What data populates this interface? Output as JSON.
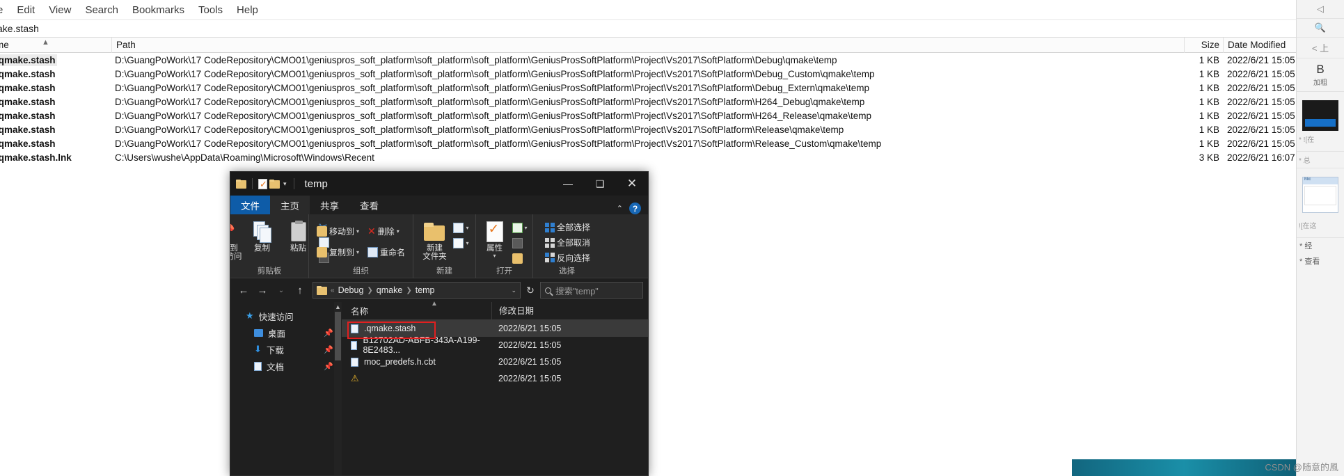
{
  "app": {
    "menu": [
      "e",
      "Edit",
      "View",
      "Search",
      "Bookmarks",
      "Tools",
      "Help"
    ],
    "search_value": "ake.stash",
    "columns": {
      "name": "me",
      "path": "Path",
      "size": "Size",
      "date": "Date Modified"
    },
    "rows": [
      {
        "name": ".qmake.stash",
        "path": "D:\\GuangPoWork\\17 CodeRepository\\CMO01\\geniuspros_soft_platform\\soft_platform\\soft_platform\\GeniusProsSoftPlatform\\Project\\Vs2017\\SoftPlatform\\Debug\\qmake\\temp",
        "size": "1 KB",
        "date": "2022/6/21 15:05",
        "selected": true
      },
      {
        "name": ".qmake.stash",
        "path": "D:\\GuangPoWork\\17 CodeRepository\\CMO01\\geniuspros_soft_platform\\soft_platform\\soft_platform\\GeniusProsSoftPlatform\\Project\\Vs2017\\SoftPlatform\\Debug_Custom\\qmake\\temp",
        "size": "1 KB",
        "date": "2022/6/21 15:05",
        "selected": false
      },
      {
        "name": ".qmake.stash",
        "path": "D:\\GuangPoWork\\17 CodeRepository\\CMO01\\geniuspros_soft_platform\\soft_platform\\soft_platform\\GeniusProsSoftPlatform\\Project\\Vs2017\\SoftPlatform\\Debug_Extern\\qmake\\temp",
        "size": "1 KB",
        "date": "2022/6/21 15:05",
        "selected": false
      },
      {
        "name": ".qmake.stash",
        "path": "D:\\GuangPoWork\\17 CodeRepository\\CMO01\\geniuspros_soft_platform\\soft_platform\\soft_platform\\GeniusProsSoftPlatform\\Project\\Vs2017\\SoftPlatform\\H264_Debug\\qmake\\temp",
        "size": "1 KB",
        "date": "2022/6/21 15:05",
        "selected": false
      },
      {
        "name": ".qmake.stash",
        "path": "D:\\GuangPoWork\\17 CodeRepository\\CMO01\\geniuspros_soft_platform\\soft_platform\\soft_platform\\GeniusProsSoftPlatform\\Project\\Vs2017\\SoftPlatform\\H264_Release\\qmake\\temp",
        "size": "1 KB",
        "date": "2022/6/21 15:05",
        "selected": false
      },
      {
        "name": ".qmake.stash",
        "path": "D:\\GuangPoWork\\17 CodeRepository\\CMO01\\geniuspros_soft_platform\\soft_platform\\soft_platform\\GeniusProsSoftPlatform\\Project\\Vs2017\\SoftPlatform\\Release\\qmake\\temp",
        "size": "1 KB",
        "date": "2022/6/21 15:05",
        "selected": false
      },
      {
        "name": ".qmake.stash",
        "path": "D:\\GuangPoWork\\17 CodeRepository\\CMO01\\geniuspros_soft_platform\\soft_platform\\soft_platform\\GeniusProsSoftPlatform\\Project\\Vs2017\\SoftPlatform\\Release_Custom\\qmake\\temp",
        "size": "1 KB",
        "date": "2022/6/21 15:05",
        "selected": false
      },
      {
        "name": ".qmake.stash.lnk",
        "path": "C:\\Users\\wushe\\AppData\\Roaming\\Microsoft\\Windows\\Recent",
        "size": "3 KB",
        "date": "2022/6/21 16:07",
        "selected": false
      }
    ]
  },
  "explorer": {
    "title": "temp",
    "window_buttons": {
      "minimize": "—",
      "maximize": "❑",
      "close": "✕"
    },
    "tabs": [
      {
        "label": "文件",
        "kind": "file"
      },
      {
        "label": "主页",
        "kind": "active"
      },
      {
        "label": "共享",
        "kind": "normal"
      },
      {
        "label": "查看",
        "kind": "normal"
      }
    ],
    "help_label": "?",
    "collapse_caret": "⌃",
    "ribbon": {
      "groups": [
        {
          "label": "剪贴板",
          "big": [
            {
              "caption_line1": "固定到",
              "caption_line2": "快速访问",
              "icon": "pin-icon"
            },
            {
              "caption_line1": "复制",
              "caption_line2": "",
              "icon": "copy-icon"
            },
            {
              "caption_line1": "粘贴",
              "caption_line2": "",
              "icon": "paste-icon"
            }
          ],
          "small": [
            {
              "label": "",
              "icon": "cut-icon"
            },
            {
              "label": "",
              "icon": "copy-path-icon"
            },
            {
              "label": "",
              "icon": "paste-shortcut-icon"
            }
          ]
        },
        {
          "label": "组织",
          "small": [
            {
              "label": "移动到",
              "icon": "move-to-icon",
              "caret": "▾"
            },
            {
              "label": "删除",
              "icon": "delete-x-icon",
              "caret": "▾"
            },
            {
              "label": "复制到",
              "icon": "copy-to-icon",
              "caret": "▾"
            },
            {
              "label": "重命名",
              "icon": "rename-icon",
              "caret": ""
            }
          ]
        },
        {
          "label": "新建",
          "big": [
            {
              "caption_line1": "新建",
              "caption_line2": "文件夹",
              "icon": "new-folder-icon"
            }
          ],
          "small": [
            {
              "label": "",
              "icon": "new-item-icon",
              "caret": "▾"
            },
            {
              "label": "",
              "icon": "easy-access-icon",
              "caret": "▾"
            }
          ]
        },
        {
          "label": "打开",
          "big": [
            {
              "caption_line1": "属性",
              "caption_line2": "",
              "icon": "properties-icon"
            }
          ],
          "small": [
            {
              "label": "",
              "icon": "open-with-icon",
              "caret": "▾"
            },
            {
              "label": "",
              "icon": "edit-icon",
              "caret": ""
            },
            {
              "label": "",
              "icon": "history-icon",
              "caret": ""
            }
          ]
        },
        {
          "label": "选择",
          "small": [
            {
              "label": "全部选择",
              "icon": "select-all-icon"
            },
            {
              "label": "全部取消",
              "icon": "select-none-icon"
            },
            {
              "label": "反向选择",
              "icon": "invert-selection-icon"
            }
          ]
        }
      ]
    },
    "nav": {
      "back": "←",
      "forward": "→",
      "recent": "⌄",
      "up": "↑",
      "breadcrumb": [
        "Debug",
        "qmake",
        "temp"
      ],
      "breadcrumb_prefix": "«",
      "dropdown": "⌄",
      "refresh": "↻",
      "search_placeholder": "搜索\"temp\""
    },
    "sidebar": [
      {
        "label": "快速访问",
        "icon": "star-icon",
        "pinned": false
      },
      {
        "label": "桌面",
        "icon": "desktop-icon",
        "pinned": true
      },
      {
        "label": "下载",
        "icon": "downloads-icon",
        "pinned": true
      },
      {
        "label": "文档",
        "icon": "documents-icon",
        "pinned": true
      }
    ],
    "list": {
      "columns": [
        "名称",
        "修改日期"
      ],
      "items": [
        {
          "name": ".qmake.stash",
          "date": "2022/6/21 15:05",
          "selected": true,
          "highlighted": true,
          "icon": "file-icon"
        },
        {
          "name": "B12702AD-ABFB-343A-A199-8E2483...",
          "date": "2022/6/21 15:05",
          "selected": false,
          "highlighted": false,
          "icon": "file-icon"
        },
        {
          "name": "moc_predefs.h.cbt",
          "date": "2022/6/21 15:05",
          "selected": false,
          "highlighted": false,
          "icon": "file-icon"
        },
        {
          "name": "",
          "date": "2022/6/21 15:05",
          "selected": false,
          "highlighted": false,
          "icon": "warning-icon"
        }
      ]
    }
  },
  "right_panel": {
    "back_icon": "◁",
    "search_icon": "search-icon",
    "nav_prev": "< 上",
    "bold_glyph": "B",
    "bold_caption": "加粗",
    "note1": "* ![在",
    "note2": "* 总",
    "window_title": "Mic",
    "note3": "![在这",
    "note4": "* 经",
    "note5": "* 查看"
  },
  "watermark": "CSDN @随意的風"
}
